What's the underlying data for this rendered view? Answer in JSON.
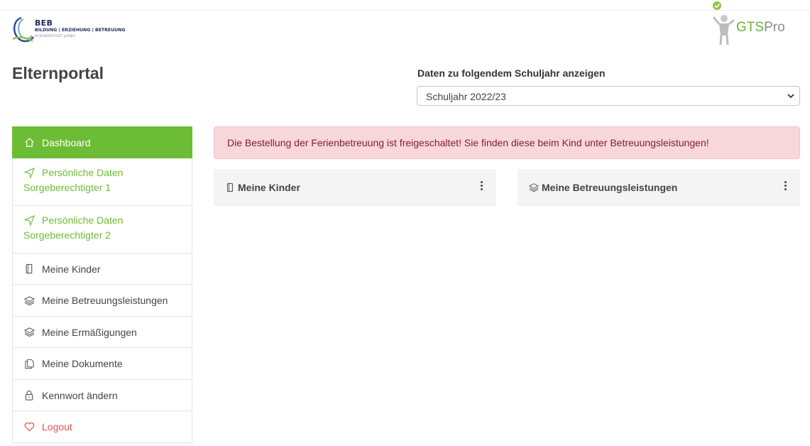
{
  "logo": {
    "brand": "BEB",
    "tagline": "BILDUNG | ERZIEHUNG | BETREUUNG",
    "small": "IN NORDERSTEDT gGMBH"
  },
  "gts_logo": {
    "gts": "GTS",
    "pro": "Pro"
  },
  "page_title": "Elternportal",
  "year_selector": {
    "label": "Daten zu folgendem Schuljahr anzeigen",
    "selected": "Schuljahr 2022/23"
  },
  "sidebar": {
    "items": [
      {
        "label": "Dashboard",
        "icon": "home-icon"
      },
      {
        "label": "Persönliche Daten Sorgeberechtigter 1",
        "icon": "send-icon"
      },
      {
        "label": "Persönliche Daten Sorgeberechtigter 2",
        "icon": "send-icon"
      },
      {
        "label": "Meine Kinder",
        "icon": "tablet-icon"
      },
      {
        "label": "Meine Betreuungsleistungen",
        "icon": "layers-icon"
      },
      {
        "label": "Meine Ermäßigungen",
        "icon": "layers-icon"
      },
      {
        "label": "Meine Dokumente",
        "icon": "documents-icon"
      },
      {
        "label": "Kennwort ändern",
        "icon": "lock-icon"
      },
      {
        "label": "Logout",
        "icon": "heart-icon"
      }
    ]
  },
  "alert": {
    "text": "Die Bestellung der Ferienbetreuung ist freigeschaltet! Sie finden diese beim Kind unter Betreuungsleistungen!"
  },
  "cards": {
    "kids": {
      "title": "Meine Kinder",
      "icon": "tablet-icon"
    },
    "services": {
      "title": "Meine Betreuungsleistungen",
      "icon": "layers-icon"
    }
  },
  "colors": {
    "accent_green": "#6cbd35",
    "alert_bg": "#f8d7da",
    "alert_text": "#842029",
    "logout_red": "#d9534f"
  }
}
